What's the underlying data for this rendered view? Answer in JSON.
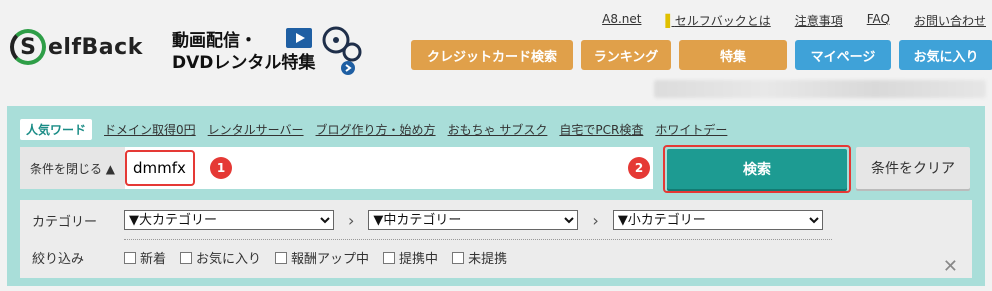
{
  "brand": {
    "logo_letter": "S",
    "logo_rest": "elfBack"
  },
  "promo": {
    "line1": "動画配信・",
    "line2": "DVDレンタル特集"
  },
  "top_links": [
    "A8.net",
    "セルフバックとは",
    "注意事項",
    "FAQ",
    "お問い合わせ"
  ],
  "nav_buttons": [
    {
      "label": "クレジットカード検索",
      "color": "#e0a04a",
      "width": 162
    },
    {
      "label": "ランキング",
      "color": "#e0a04a",
      "width": 90
    },
    {
      "label": "特集",
      "color": "#e0a04a",
      "width": 108
    },
    {
      "label": "マイページ",
      "color": "#3fa2d8",
      "width": 96
    },
    {
      "label": "お気に入り",
      "color": "#3fa2d8",
      "width": 94
    }
  ],
  "popular": {
    "badge": "人気ワード",
    "words": [
      "ドメイン取得0円",
      "レンタルサーバー",
      "ブログ作り方・始め方",
      "おもちゃ サブスク",
      "自宅でPCR検査",
      "ホワイトデー"
    ]
  },
  "search": {
    "toggle_label": "条件を閉じる ▲",
    "query_value": "dmmfx",
    "search_label": "検索",
    "clear_label": "条件をクリア",
    "markers": [
      "1",
      "2"
    ]
  },
  "filters": {
    "category_label": "カテゴリー",
    "selects": [
      "▼大カテゴリー",
      "▼中カテゴリー",
      "▼小カテゴリー"
    ],
    "narrow_label": "絞り込み",
    "checkboxes": [
      "新着",
      "お気に入り",
      "報酬アップ中",
      "提携中",
      "未提携"
    ],
    "close_glyph": "✕"
  },
  "colors": {
    "panel_bg": "#a9ded9",
    "search_btn": "#1d9b92",
    "marker_red": "#e53935"
  }
}
